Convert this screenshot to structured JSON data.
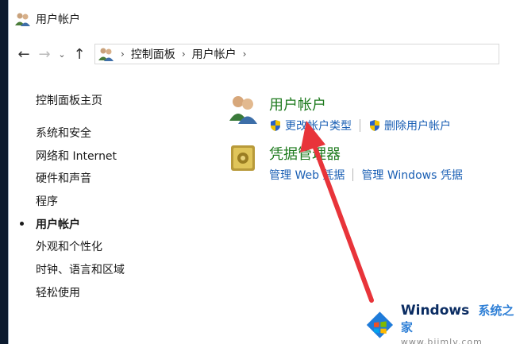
{
  "window": {
    "title": "用户帐户"
  },
  "nav": {
    "back_icon": "←",
    "forward_icon": "→",
    "recent_icon": "⌄",
    "up_icon": "↑"
  },
  "address": {
    "crumbs": [
      "控制面板",
      "用户帐户"
    ],
    "sep": "›"
  },
  "sidebar": {
    "home": "控制面板主页",
    "items": [
      "系统和安全",
      "网络和 Internet",
      "硬件和声音",
      "程序",
      "用户帐户",
      "外观和个性化",
      "时钟、语言和区域",
      "轻松使用"
    ],
    "active_index": 4
  },
  "sections": {
    "users": {
      "title": "用户帐户",
      "link1": "更改帐户类型",
      "link2": "删除用户帐户"
    },
    "credentials": {
      "title": "凭据管理器",
      "link1": "管理 Web 凭据",
      "link2": "管理 Windows 凭据"
    }
  },
  "watermark": {
    "brand": "Windows",
    "cn": "系统之家",
    "url": "www.bjjmlv.com"
  },
  "colors": {
    "section_title": "#1e7a1e",
    "link": "#1a5fb4",
    "arrow": "#e8343a"
  }
}
